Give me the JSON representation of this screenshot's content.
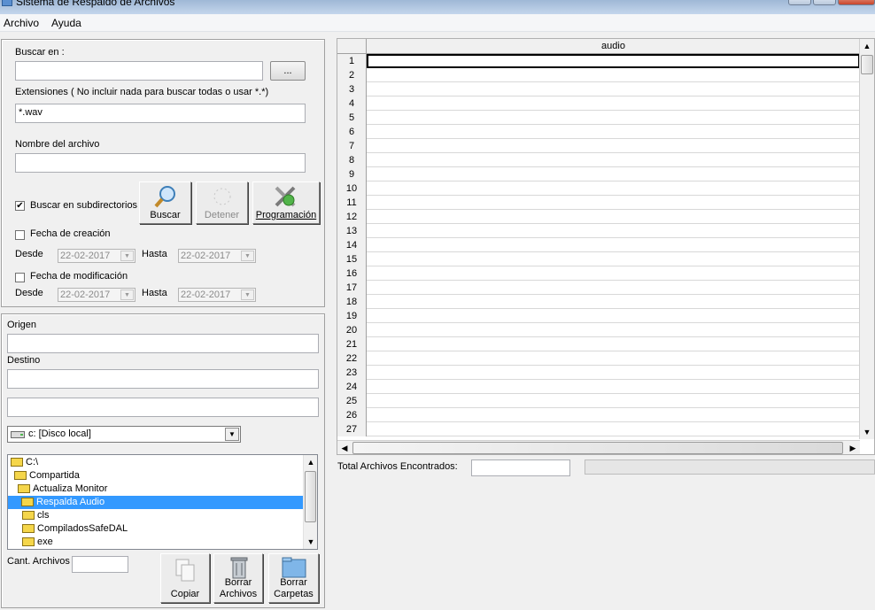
{
  "window": {
    "title": "Sistema de Respaldo de Archivos"
  },
  "menu": {
    "archivo": "Archivo",
    "ayuda": "Ayuda"
  },
  "search": {
    "buscar_en_label": "Buscar en :",
    "buscar_en_value": "",
    "browse_label": "...",
    "extensiones_label": "Extensiones ( No incluir nada para buscar todas o usar *.*)",
    "extensiones_value": "*.wav",
    "nombre_label": "Nombre del archivo",
    "nombre_value": "",
    "subdir_label": "Buscar en subdirectorios",
    "subdir_checked": true,
    "creacion_label": "Fecha de creación",
    "modificacion_label": "Fecha de modificación",
    "desde_label": "Desde",
    "hasta_label": "Hasta",
    "creacion_desde": "22-02-2017",
    "creacion_hasta": "22-02-2017",
    "mod_desde": "22-02-2017",
    "mod_hasta": "22-02-2017",
    "buscar_btn": "Buscar",
    "detener_btn": "Detener",
    "programacion_btn": "Programación"
  },
  "copy": {
    "origen_label": "Origen",
    "origen_value": "",
    "destino_label": "Destino",
    "destino_value": "",
    "path_value": "",
    "drive": "c: [Disco local]",
    "cant_label": "Cant. Archivos",
    "cant_value": "",
    "copiar_btn": "Copiar",
    "borrar_archivos_btn_1": "Borrar",
    "borrar_archivos_btn_2": "Archivos",
    "borrar_carpetas_btn_1": "Borrar",
    "borrar_carpetas_btn_2": "Carpetas"
  },
  "tree": [
    "C:\\",
    "Compartida",
    "Actualiza Monitor",
    "Respalda Audio",
    "cls",
    "CompiladosSafeDAL",
    "exe"
  ],
  "grid": {
    "column": "audio",
    "rows": [
      "1",
      "2",
      "3",
      "4",
      "5",
      "6",
      "7",
      "8",
      "9",
      "10",
      "11",
      "12",
      "13",
      "14",
      "15",
      "16",
      "17",
      "18",
      "19",
      "20",
      "21",
      "22",
      "23",
      "24",
      "25",
      "26",
      "27"
    ]
  },
  "footer": {
    "total_label": "Total Archivos Encontrados:",
    "total_value": ""
  },
  "icons": [
    "folder-icon",
    "search-icon",
    "stop-icon",
    "tools-icon",
    "copy-icon",
    "trash-icon",
    "folder-delete-icon",
    "drive-icon"
  ]
}
